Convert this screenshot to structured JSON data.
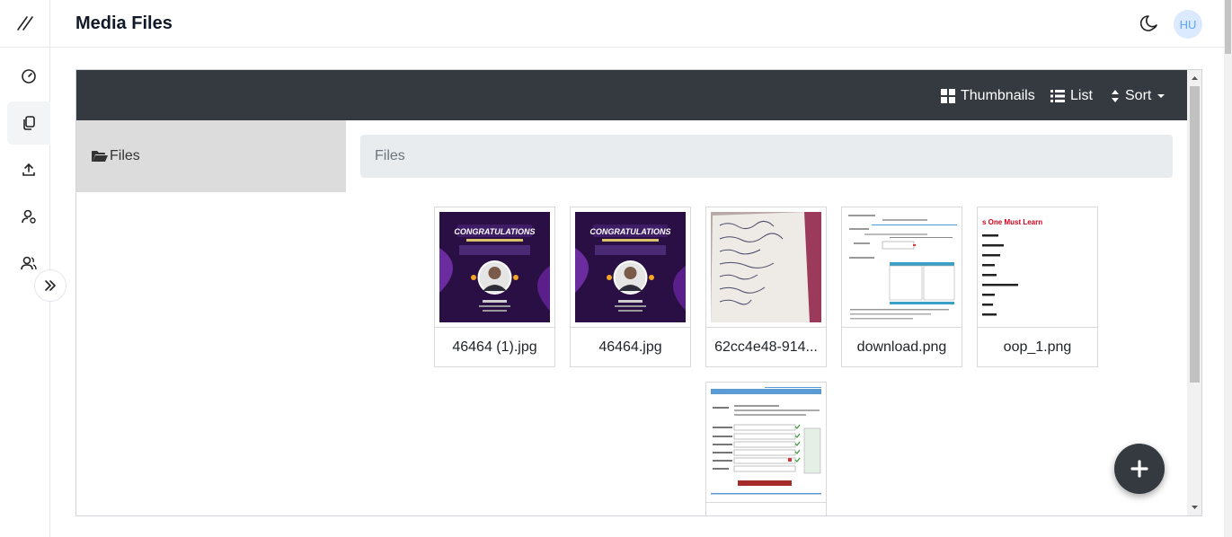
{
  "header": {
    "title": "Media Files",
    "avatar_initials": "HU"
  },
  "sidebar": {
    "items": [
      {
        "icon": "dashboard-icon",
        "active": false
      },
      {
        "icon": "files-icon",
        "active": true
      },
      {
        "icon": "upload-icon",
        "active": false
      },
      {
        "icon": "user-icon",
        "active": false
      },
      {
        "icon": "users-icon",
        "active": false
      }
    ]
  },
  "toolbar": {
    "thumbnails_label": "Thumbnails",
    "list_label": "List",
    "sort_label": "Sort"
  },
  "tree": {
    "root_label": "Files"
  },
  "breadcrumb": {
    "label": "Files"
  },
  "files": [
    {
      "name": "46464 (1).jpg"
    },
    {
      "name": "46464.jpg"
    },
    {
      "name": "62cc4e48-914..."
    },
    {
      "name": "download.png"
    },
    {
      "name": "oop_1.png"
    },
    {
      "name": ""
    }
  ],
  "thumb_text": {
    "congrats": "CONGRATULATIONS",
    "oop_heading": "s One Must Learn"
  },
  "colors": {
    "toolbar": "#343a40",
    "accent_purple": "#3b1d5c",
    "avatar_bg": "#dbeafe",
    "avatar_text": "#60a5fa"
  }
}
